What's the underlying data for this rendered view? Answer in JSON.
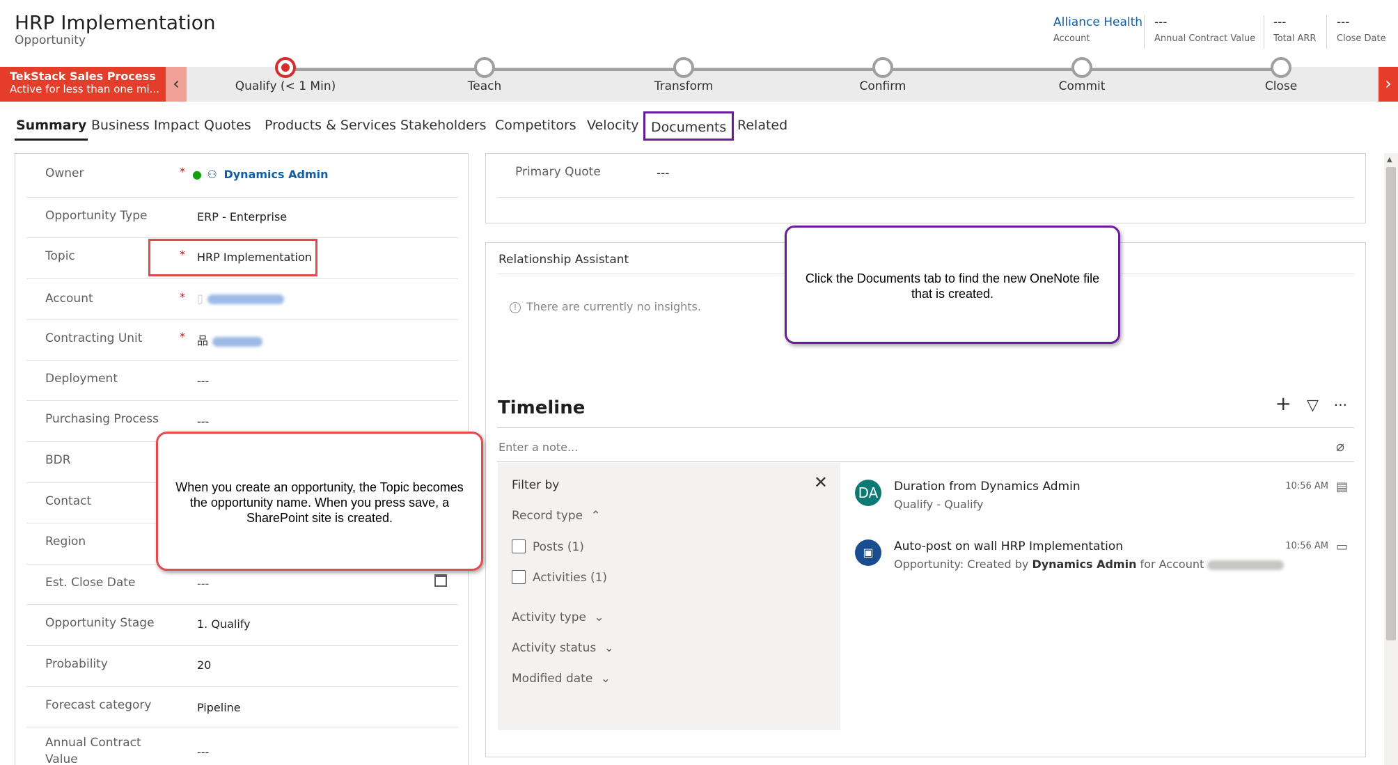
{
  "header": {
    "title": "HRP Implementation",
    "entity": "Opportunity",
    "fields": [
      {
        "value": "Alliance Health",
        "label": "Account"
      },
      {
        "value": "---",
        "label": "Annual Contract Value"
      },
      {
        "value": "---",
        "label": "Total ARR"
      },
      {
        "value": "---",
        "label": "Close Date"
      }
    ]
  },
  "process": {
    "name": "TekStack Sales Process",
    "status": "Active for less than one mi...",
    "stages": [
      {
        "label": "Qualify  (< 1 Min)"
      },
      {
        "label": "Teach"
      },
      {
        "label": "Transform"
      },
      {
        "label": "Confirm"
      },
      {
        "label": "Commit"
      },
      {
        "label": "Close"
      }
    ],
    "prev_icon": "chevron-left-icon",
    "next_icon": "chevron-right-icon"
  },
  "tabs": [
    "Summary",
    "Business Impact",
    "Quotes",
    "Products & Services",
    "Stakeholders",
    "Competitors",
    "Velocity",
    "Documents",
    "Related"
  ],
  "form": {
    "owner": {
      "label": "Owner",
      "value": "Dynamics Admin"
    },
    "opportunity_type": {
      "label": "Opportunity Type",
      "value": "ERP - Enterprise"
    },
    "topic": {
      "label": "Topic",
      "value": "HRP Implementation"
    },
    "account": {
      "label": "Account"
    },
    "contracting_unit": {
      "label": "Contracting Unit"
    },
    "deployment": {
      "label": "Deployment",
      "value": "---"
    },
    "purchasing_process": {
      "label": "Purchasing Process",
      "value": "---"
    },
    "bdr": {
      "label": "BDR"
    },
    "contact": {
      "label": "Contact"
    },
    "region": {
      "label": "Region"
    },
    "est_close_date": {
      "label": "Est. Close Date",
      "value": "---"
    },
    "opportunity_stage": {
      "label": "Opportunity Stage",
      "value": "1. Qualify"
    },
    "probability": {
      "label": "Probability",
      "value": "20"
    },
    "forecast_category": {
      "label": "Forecast category",
      "value": "Pipeline"
    },
    "annual_contract_value": {
      "label": "Annual Contract Value",
      "value": "---"
    }
  },
  "primary_quote": {
    "label": "Primary Quote",
    "value": "---"
  },
  "relationship_assistant": {
    "title": "Relationship Assistant",
    "empty": "There are currently no insights."
  },
  "timeline": {
    "title": "Timeline",
    "note_placeholder": "Enter a note...",
    "filter": {
      "title": "Filter by",
      "record_type": "Record type",
      "posts": "Posts (1)",
      "activities": "Activities (1)",
      "activity_type": "Activity type",
      "activity_status": "Activity status",
      "modified_date": "Modified date"
    },
    "entries": [
      {
        "avatar": "DA",
        "avatar_color": "#0b7a75",
        "title": "Duration from Dynamics Admin",
        "subtitle": "Qualify - Qualify",
        "time": "10:56 AM"
      },
      {
        "avatar": "",
        "avatar_color": "#1a4d8f",
        "title": "Auto-post on wall HRP Implementation",
        "sub_prefix": "Opportunity: Created by ",
        "sub_user": "Dynamics Admin",
        "sub_suffix": " for Account ",
        "time": "10:56 AM"
      }
    ]
  },
  "callouts": {
    "topic": "When you create an opportunity, the Topic becomes the opportunity name.  When you press save, a SharePoint site is created.",
    "documents": "Click the Documents tab to find the new OneNote file that is created."
  },
  "colors": {
    "accent": "#e43e2b",
    "link": "#115ea3",
    "callout_red": "#e34b4b",
    "callout_purple": "#6a1b9a"
  }
}
